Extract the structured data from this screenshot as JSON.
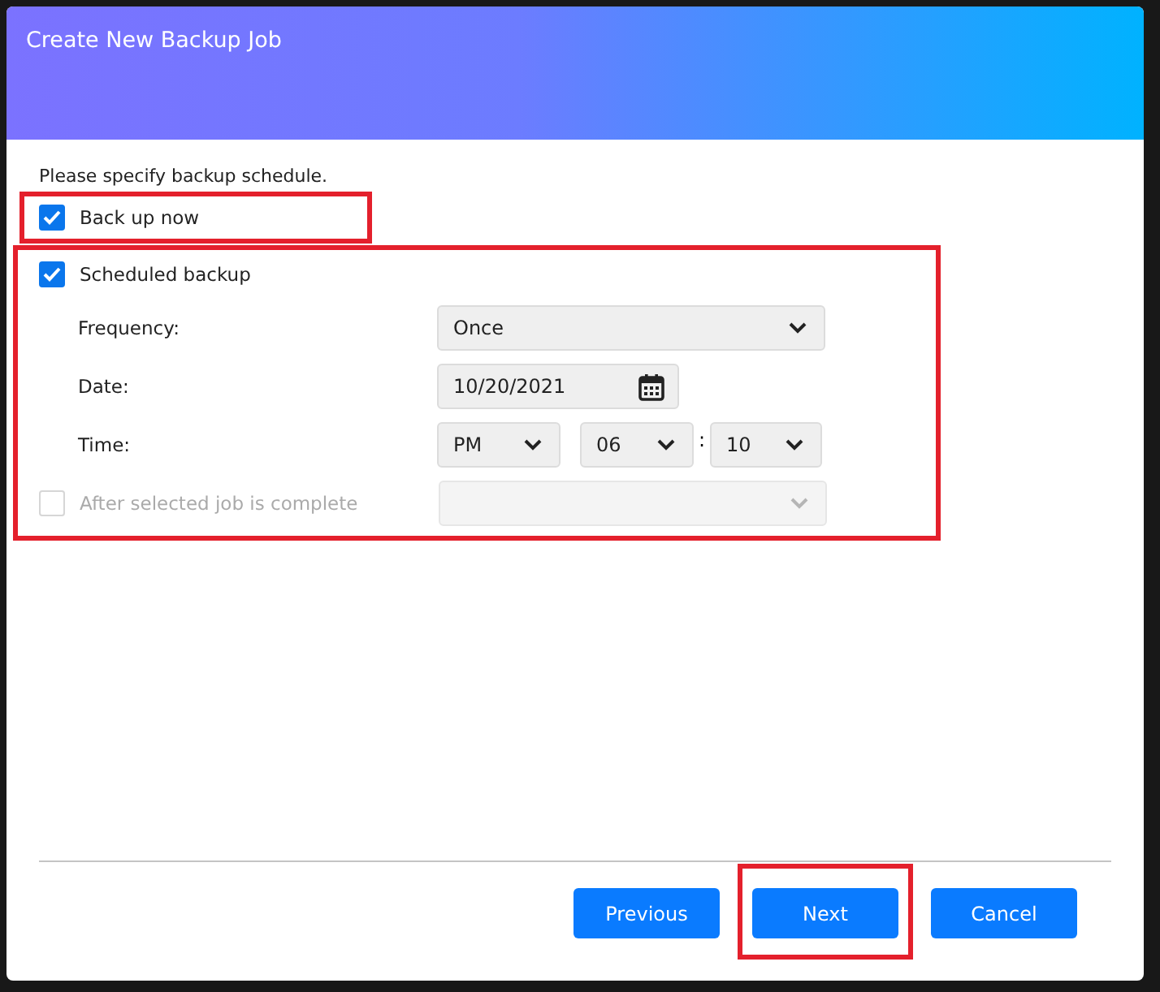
{
  "dialog": {
    "title": "Create New Backup Job",
    "instruction": "Please specify backup schedule.",
    "back_up_now": {
      "label": "Back up now",
      "checked": true,
      "highlighted": true
    },
    "scheduled": {
      "label": "Scheduled backup",
      "checked": true,
      "highlighted": true,
      "frequency": {
        "label": "Frequency:",
        "value": "Once"
      },
      "date": {
        "label": "Date:",
        "value": "10/20/2021"
      },
      "time": {
        "label": "Time:",
        "period": "PM",
        "hour": "06",
        "separator": ":",
        "minute": "10"
      },
      "after_job": {
        "label": "After selected job is complete",
        "checked": false,
        "disabled": true
      }
    },
    "buttons": [
      {
        "label": "Previous",
        "highlighted": false
      },
      {
        "label": "Next",
        "highlighted": true
      },
      {
        "label": "Cancel",
        "highlighted": false
      }
    ]
  }
}
